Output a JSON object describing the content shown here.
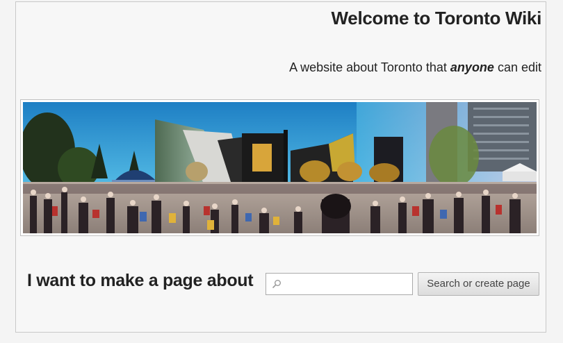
{
  "header": {
    "title": "Welcome to Toronto Wiki",
    "tagline_before": "A website about Toronto that ",
    "tagline_emphasis": "anyone",
    "tagline_after": " can edit"
  },
  "banner": {
    "image_kind": "panoramic photo of a crowded city square"
  },
  "create_page": {
    "prompt": "I want to make a page about",
    "search_value": "",
    "button_label": "Search or create page"
  },
  "icons": {
    "search": "search-icon"
  },
  "colors": {
    "text": "#222222",
    "frame_border": "#c8c8c8",
    "button_bg": "#e6e6e6",
    "sky": "#3aa6d8"
  }
}
